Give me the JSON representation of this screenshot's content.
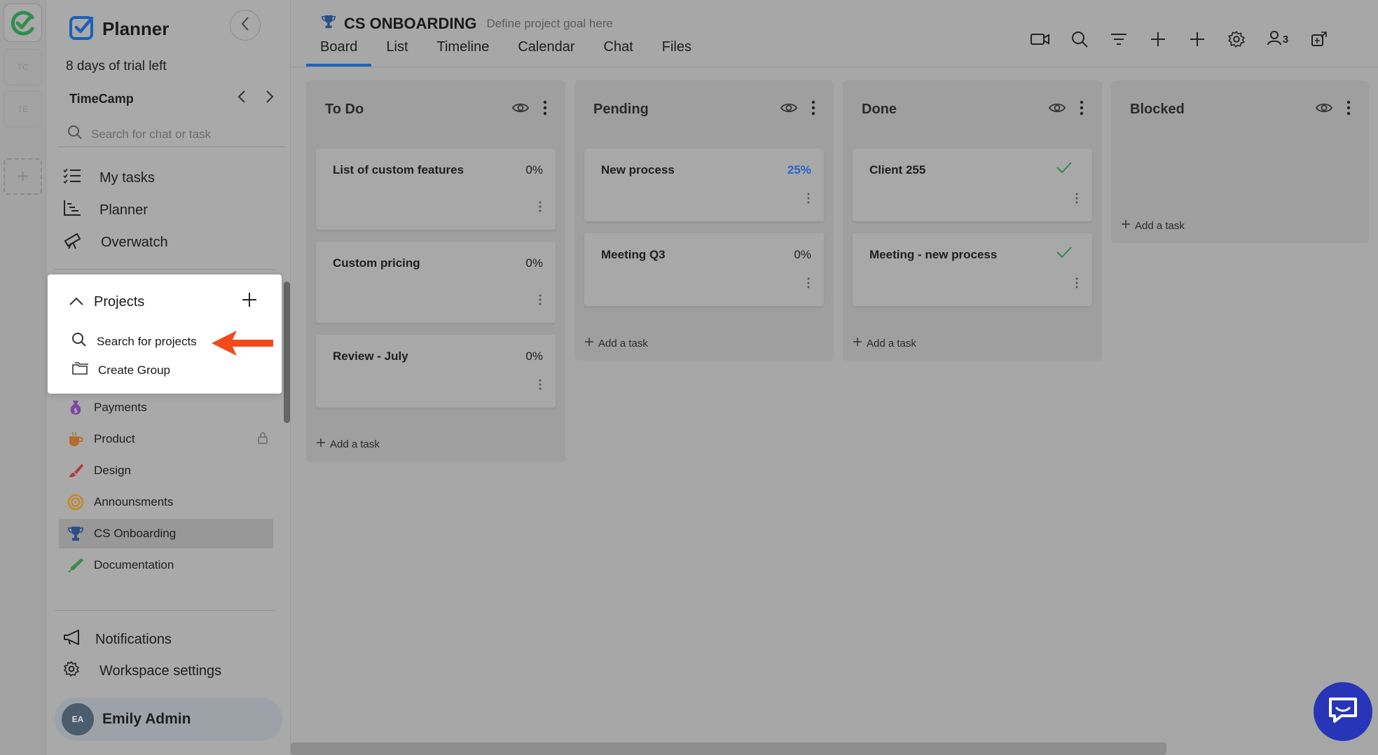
{
  "workspace_strip": {
    "tiles": [
      "TC",
      "TE"
    ],
    "add_label": "+"
  },
  "sidebar": {
    "app_title": "Planner",
    "trial": "8 days of trial left",
    "workspace": "TimeCamp",
    "search_placeholder": "Search for chat or task",
    "nav": [
      {
        "label": "My tasks",
        "icon": "tasks-list-icon"
      },
      {
        "label": "Planner",
        "icon": "planner-chart-icon"
      },
      {
        "label": "Overwatch",
        "icon": "telescope-icon"
      }
    ],
    "projects": [
      {
        "label": "Payments",
        "icon": "money-bag-icon",
        "locked": false
      },
      {
        "label": "Product",
        "icon": "coffee-cup-icon",
        "locked": true
      },
      {
        "label": "Design",
        "icon": "paintbrush-icon",
        "locked": false
      },
      {
        "label": "Announsments",
        "icon": "target-icon",
        "locked": false
      },
      {
        "label": "CS Onboarding",
        "icon": "trophy-icon",
        "locked": false,
        "active": true
      },
      {
        "label": "Documentation",
        "icon": "pen-icon",
        "locked": false
      }
    ],
    "bottom_nav": [
      {
        "label": "Notifications",
        "icon": "megaphone-icon"
      },
      {
        "label": "Workspace settings",
        "icon": "gear-icon"
      }
    ],
    "user": {
      "initials": "EA",
      "name": "Emily Admin"
    }
  },
  "popup": {
    "title": "Projects",
    "search_label": "Search for projects",
    "create_group_label": "Create Group"
  },
  "header": {
    "project_title": "CS ONBOARDING",
    "goal_placeholder": "Define project goal here",
    "tabs": [
      "Board",
      "List",
      "Timeline",
      "Calendar",
      "Chat",
      "Files"
    ],
    "active_tab": "Board",
    "members_count": "3"
  },
  "board": {
    "add_task_label": "Add a task",
    "columns": [
      {
        "title": "To Do",
        "cards": [
          {
            "title": "List of custom features",
            "progress": "0%"
          },
          {
            "title": "Custom pricing",
            "progress": "0%"
          },
          {
            "title": "Review - July",
            "progress": "0%"
          }
        ]
      },
      {
        "title": "Pending",
        "cards": [
          {
            "title": "New process",
            "progress": "25%"
          },
          {
            "title": "Meeting Q3",
            "progress": "0%"
          }
        ]
      },
      {
        "title": "Done",
        "cards": [
          {
            "title": "Client 255",
            "done": true
          },
          {
            "title": "Meeting - new process",
            "done": true
          }
        ]
      },
      {
        "title": "Blocked",
        "cards": []
      }
    ]
  },
  "colors": {
    "accent": "#1e63b8",
    "progress_highlight": "#2c63c7",
    "done_check": "#2e8b57",
    "arrow": "#f04a1d",
    "chat_button": "#2736b8"
  }
}
